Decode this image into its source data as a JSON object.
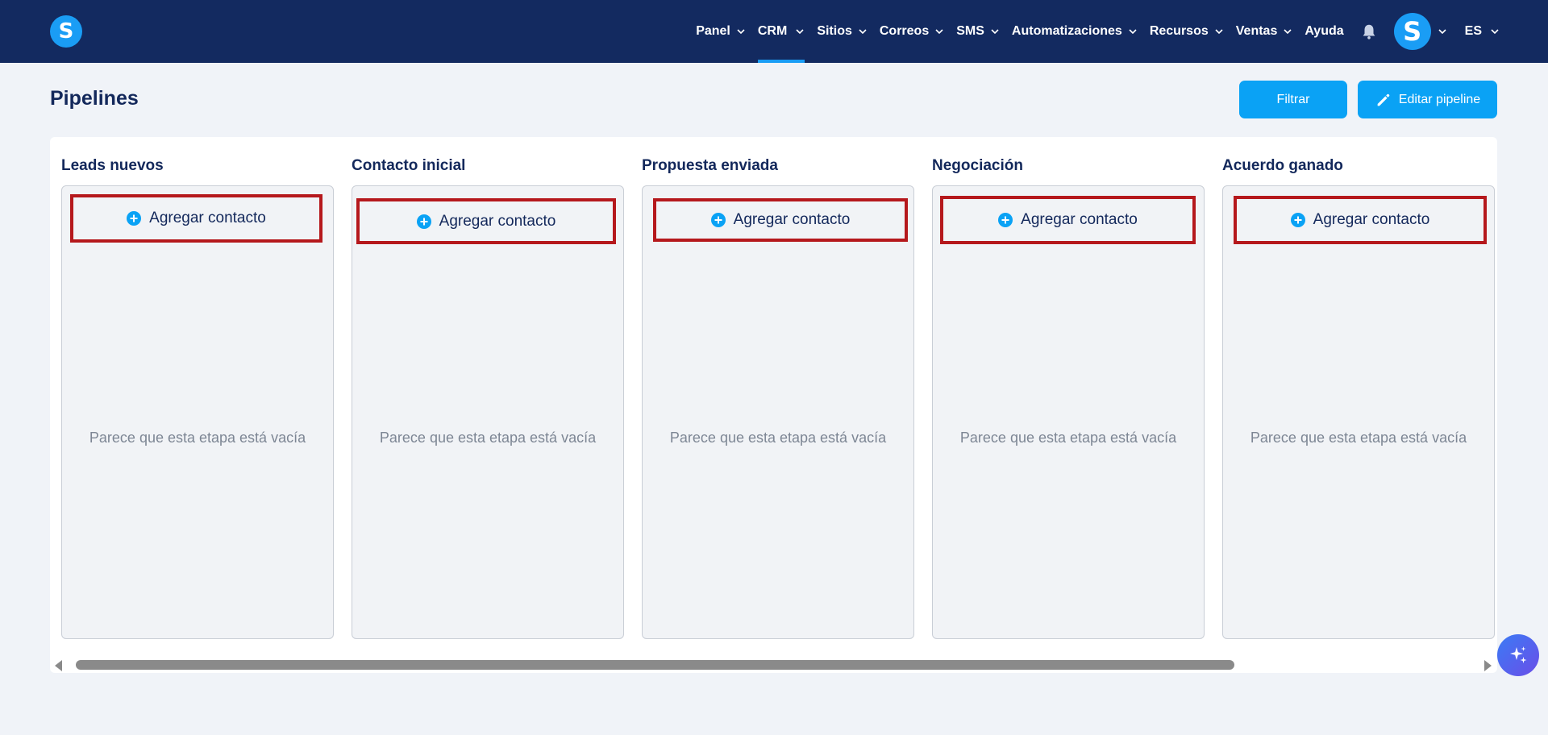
{
  "app": {
    "logo_letter": "S",
    "brand_color": "#132a60",
    "accent_color": "#0aa2f5"
  },
  "nav": {
    "items": [
      {
        "label": "Panel",
        "has_dropdown": true,
        "active": false
      },
      {
        "label": "CRM",
        "has_dropdown": true,
        "active": true
      },
      {
        "label": "Sitios",
        "has_dropdown": true,
        "active": false
      },
      {
        "label": "Correos",
        "has_dropdown": true,
        "active": false
      },
      {
        "label": "SMS",
        "has_dropdown": true,
        "active": false
      },
      {
        "label": "Automatizaciones",
        "has_dropdown": true,
        "active": false
      },
      {
        "label": "Recursos",
        "has_dropdown": true,
        "active": false
      },
      {
        "label": "Ventas",
        "has_dropdown": true,
        "active": false
      },
      {
        "label": "Ayuda",
        "has_dropdown": false,
        "active": false
      }
    ],
    "notification_icon": "bell-icon",
    "avatar_letter": "S",
    "language": "ES"
  },
  "header": {
    "title": "Pipelines",
    "filter_label": "Filtrar",
    "edit_label": "Editar pipeline"
  },
  "stages": [
    {
      "title": "Leads nuevos",
      "add_label": "Agregar contacto",
      "empty_text": "Parece que esta etapa está vacía"
    },
    {
      "title": "Contacto inicial",
      "add_label": "Agregar contacto",
      "empty_text": "Parece que esta etapa está vacía"
    },
    {
      "title": "Propuesta enviada",
      "add_label": "Agregar contacto",
      "empty_text": "Parece que esta etapa está vacía"
    },
    {
      "title": "Negociación",
      "add_label": "Agregar contacto",
      "empty_text": "Parece que esta etapa está vacía"
    },
    {
      "title": "Acuerdo ganado",
      "add_label": "Agregar contacto",
      "empty_text": "Parece que esta etapa está vacía"
    }
  ],
  "highlight_color": "#b5181c",
  "fab_icon": "sparkle-icon"
}
